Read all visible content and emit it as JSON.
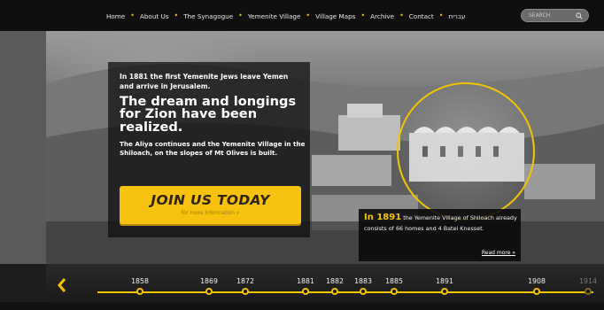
{
  "nav": {
    "items": [
      "Home",
      "About Us",
      "The Synagogue",
      "Yemenite Village",
      "Village Maps",
      "Archive",
      "Contact",
      "עברית"
    ],
    "separator": "•",
    "search_placeholder": "SEARCH"
  },
  "hero": {
    "intro": "In 1881 the first Yemenite Jews leave Yemen and arrive in Jerusalem.",
    "headline": "The dream and longings for Zion have been realized.",
    "body": "The Aliya continues and the Yemenite Village in the Shiloach, on the slopes of Mt Olives is built.",
    "cta_label": "JOIN US TODAY",
    "cta_sub": "for more information »"
  },
  "event": {
    "year_prefix": "In 1891",
    "text": " the Yemenite Village of Shiloach already consists of 66 homes and 4 Batei Knesset.",
    "read_more": "Read more »"
  },
  "timeline": {
    "prev_icon": "chevron-left-icon",
    "years": [
      "1858",
      "1869",
      "1872",
      "1881",
      "1882",
      "1883",
      "1885",
      "1891",
      "1908",
      "1914"
    ]
  },
  "colors": {
    "accent": "#f5c400",
    "nav_bg": "#0f0f0f",
    "box_bg": "#0c0c0c"
  }
}
